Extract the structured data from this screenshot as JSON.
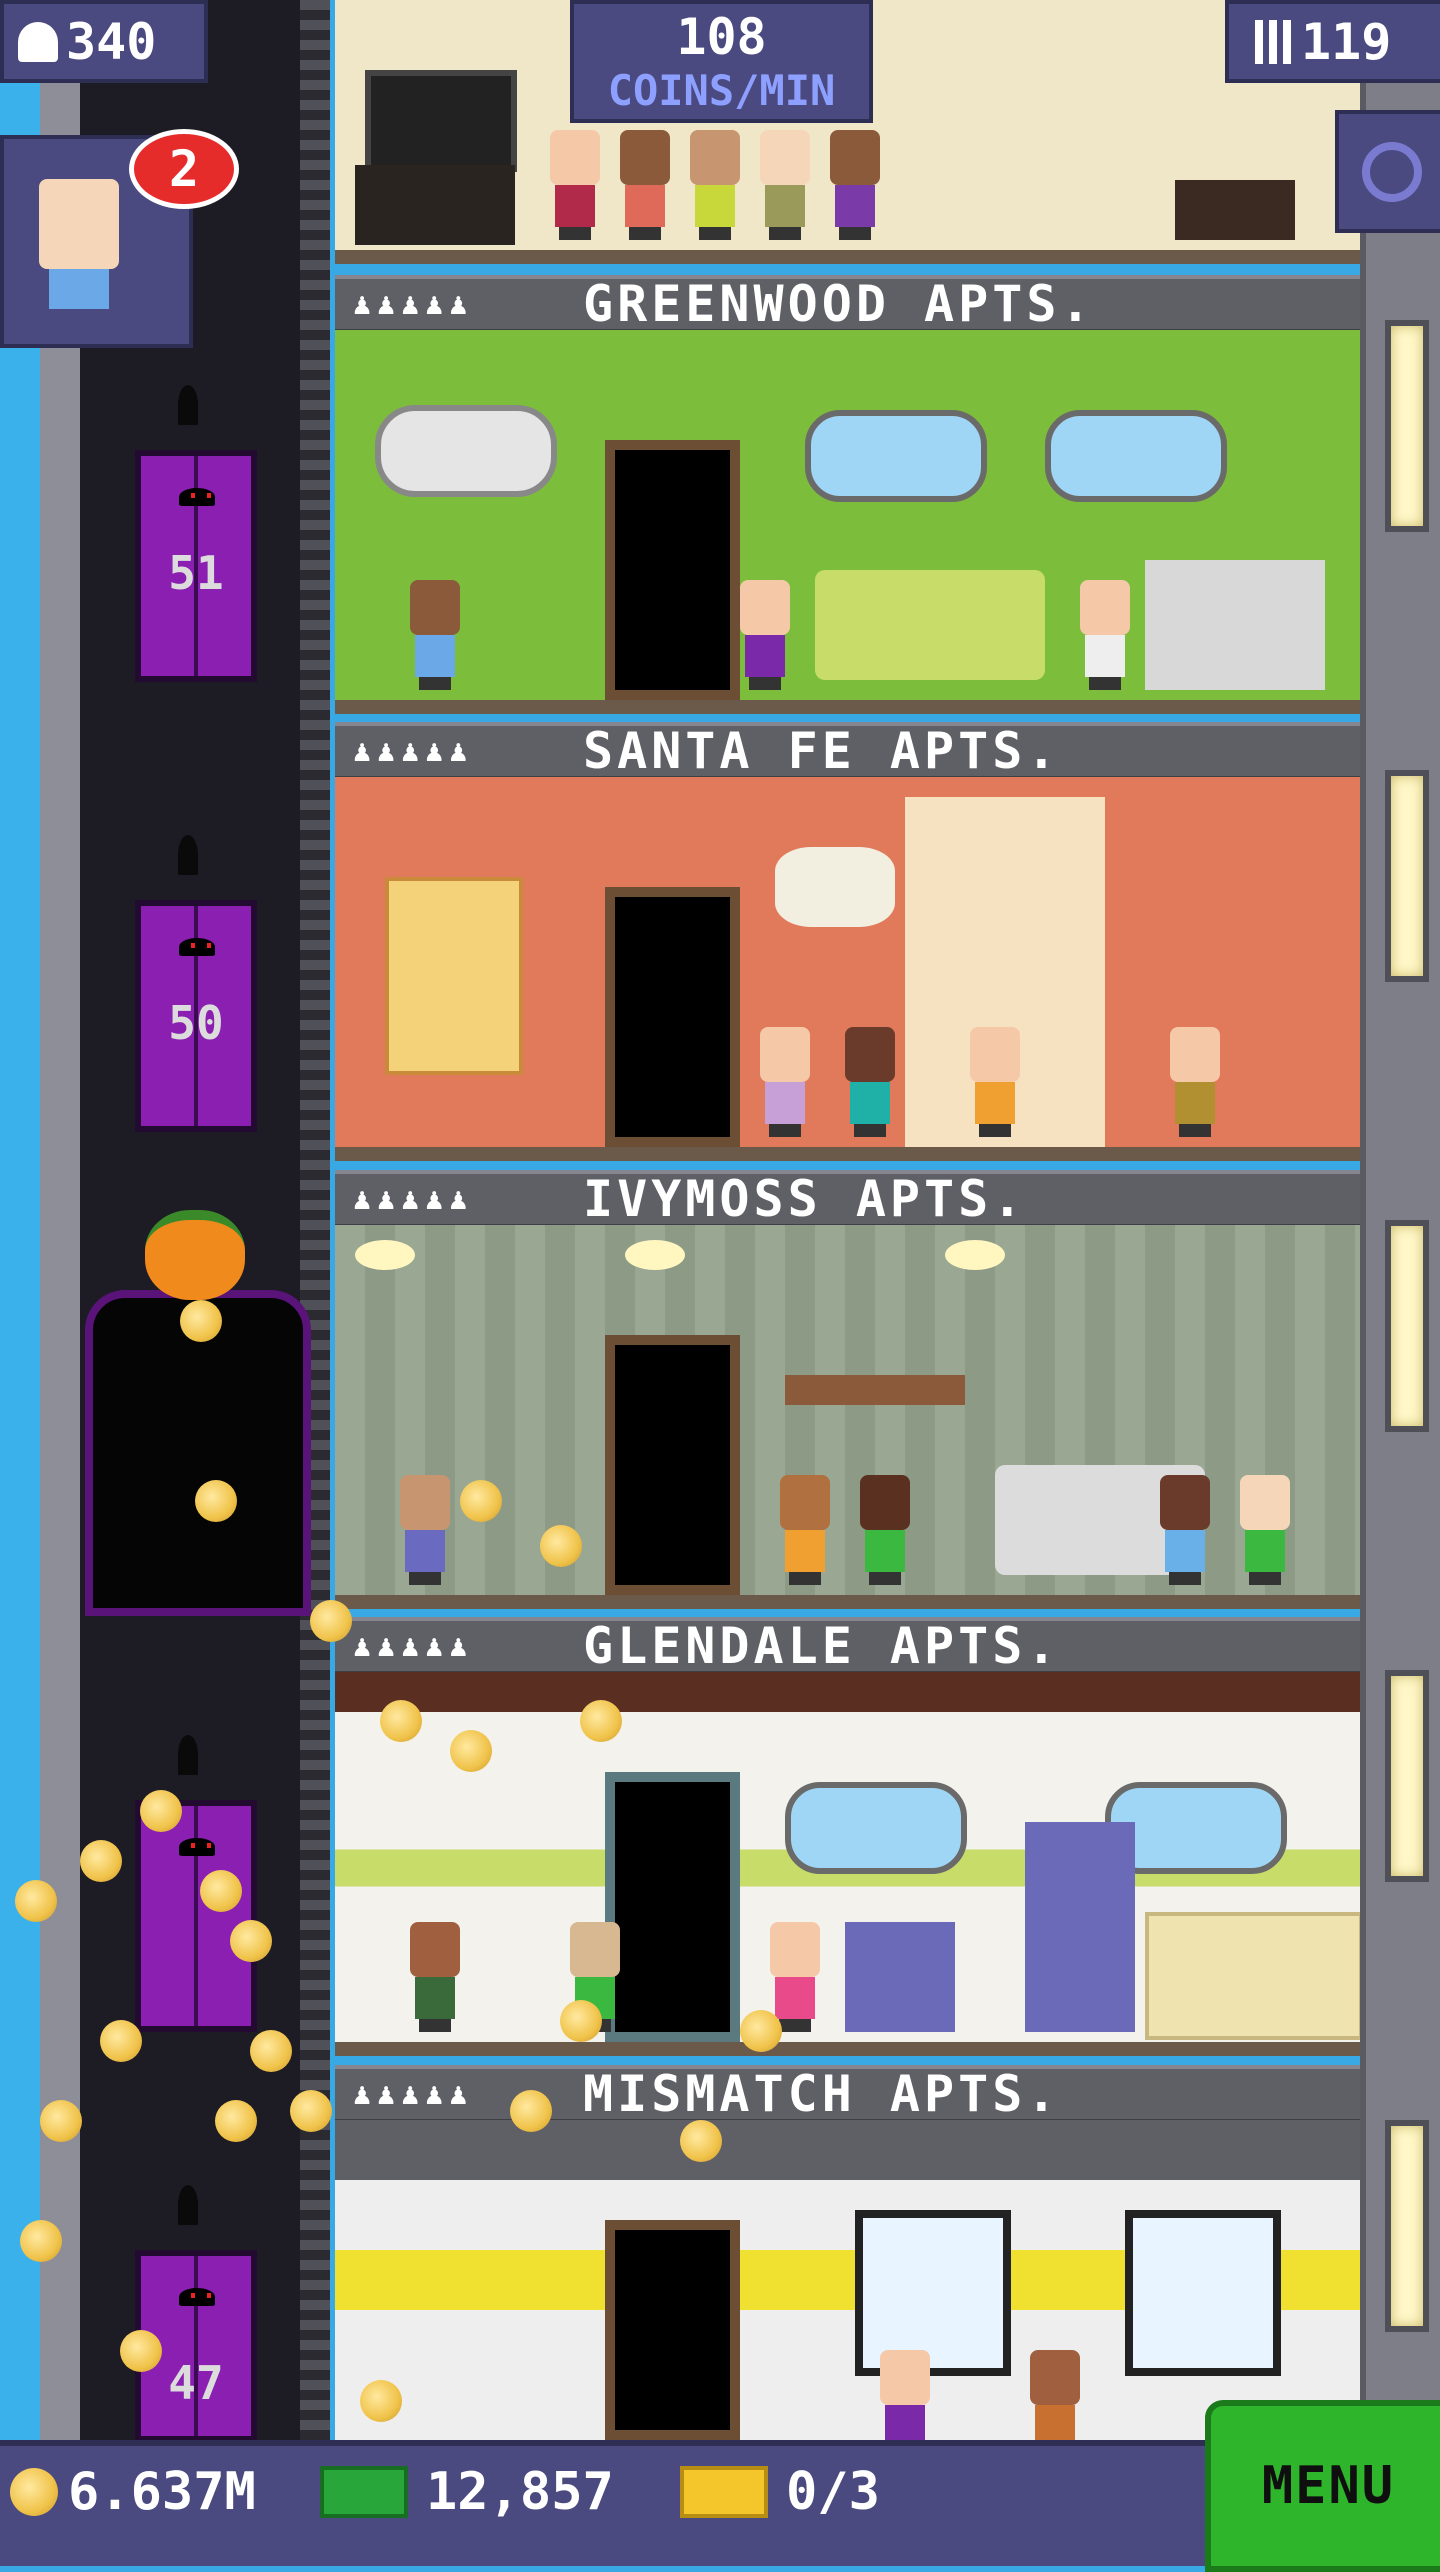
{
  "hud": {
    "population": "340",
    "floors": "119",
    "coins_per_min_value": "108",
    "coins_per_min_unit": "COINS/MIN",
    "notification_count": "2"
  },
  "elevator_floors": [
    "51",
    "50",
    "47"
  ],
  "apartments": [
    {
      "name": "GREENWOOD APTS.",
      "stars": "♟♟♟♟♟",
      "bg": "#7cbd3c"
    },
    {
      "name": "SANTA FE APTS.",
      "stars": "♟♟♟♟♟",
      "bg": "#e07a5b"
    },
    {
      "name": "IVYMOSS APTS.",
      "stars": "♟♟♟♟♟",
      "bg": "#9aa893"
    },
    {
      "name": "GLENDALE APTS.",
      "stars": "♟♟♟♟♟",
      "bg": "#f3f2ec"
    },
    {
      "name": "MISMATCH APTS.",
      "stars": "♟♟♟♟♟",
      "bg": "#eeeeee"
    }
  ],
  "bottom_bar": {
    "coins": "6.637M",
    "bux": "12,857",
    "tickets": "0/3",
    "menu_label": "MENU"
  },
  "icons": [
    "person-icon",
    "floors-icon",
    "magnifier-icon",
    "coin-icon",
    "bux-icon",
    "ticket-icon",
    "jack-o-lantern-icon",
    "bat-icon"
  ],
  "colors": {
    "hud_bg": "#4a4a80",
    "menu_green": "#2fb52c",
    "elevator_purple": "#8a1fb2",
    "coin_gold": "#f0c34a"
  }
}
